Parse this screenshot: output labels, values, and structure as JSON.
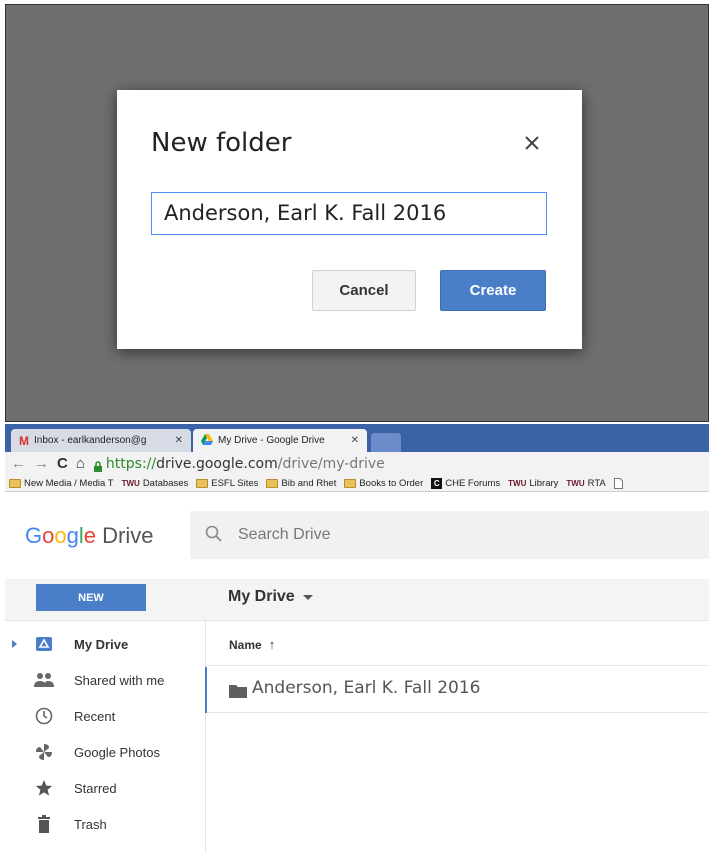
{
  "dialog": {
    "title": "New folder",
    "input_value": "Anderson, Earl K. Fall 2016",
    "cancel_label": "Cancel",
    "create_label": "Create"
  },
  "browser": {
    "tabs": [
      {
        "title": "Inbox - earlkanderson@g",
        "icon": "gmail-icon"
      },
      {
        "title": "My Drive - Google Drive",
        "icon": "drive-icon"
      }
    ],
    "url": {
      "scheme": "https://",
      "host": "drive.google.com",
      "path": "/drive/my-drive"
    },
    "bookmarks": [
      {
        "label": "New Media / Media T",
        "icon": "folder-icon"
      },
      {
        "label": "Databases",
        "icon": "twu-icon",
        "prefix": "TWU"
      },
      {
        "label": "ESFL Sites",
        "icon": "folder-icon"
      },
      {
        "label": "Bib and Rhet",
        "icon": "folder-icon"
      },
      {
        "label": "Books to Order",
        "icon": "folder-icon"
      },
      {
        "label": "CHE Forums",
        "icon": "che-icon",
        "prefix": "C"
      },
      {
        "label": "Library",
        "icon": "twu-icon",
        "prefix": "TWU"
      },
      {
        "label": "RTA",
        "icon": "twu-icon",
        "prefix": "TWU"
      }
    ]
  },
  "drive": {
    "logo_google": [
      "G",
      "o",
      "o",
      "g",
      "l",
      "e"
    ],
    "logo_product": "Drive",
    "search_placeholder": "Search Drive",
    "new_label": "NEW",
    "breadcrumb": "My Drive",
    "sidebar": [
      {
        "label": "My Drive",
        "icon": "my-drive-icon",
        "active": true
      },
      {
        "label": "Shared with me",
        "icon": "people-icon"
      },
      {
        "label": "Recent",
        "icon": "clock-icon"
      },
      {
        "label": "Google Photos",
        "icon": "pinwheel-icon"
      },
      {
        "label": "Starred",
        "icon": "star-icon"
      },
      {
        "label": "Trash",
        "icon": "trash-icon"
      }
    ],
    "column_name": "Name",
    "sort_arrow": "↑",
    "files": [
      {
        "name": "Anderson, Earl K. Fall 2016",
        "type": "folder"
      }
    ]
  },
  "colors": {
    "accent_blue": "#4a7ec8",
    "backdrop": "#6f6f6f",
    "tabstrip": "#3a62a6"
  }
}
